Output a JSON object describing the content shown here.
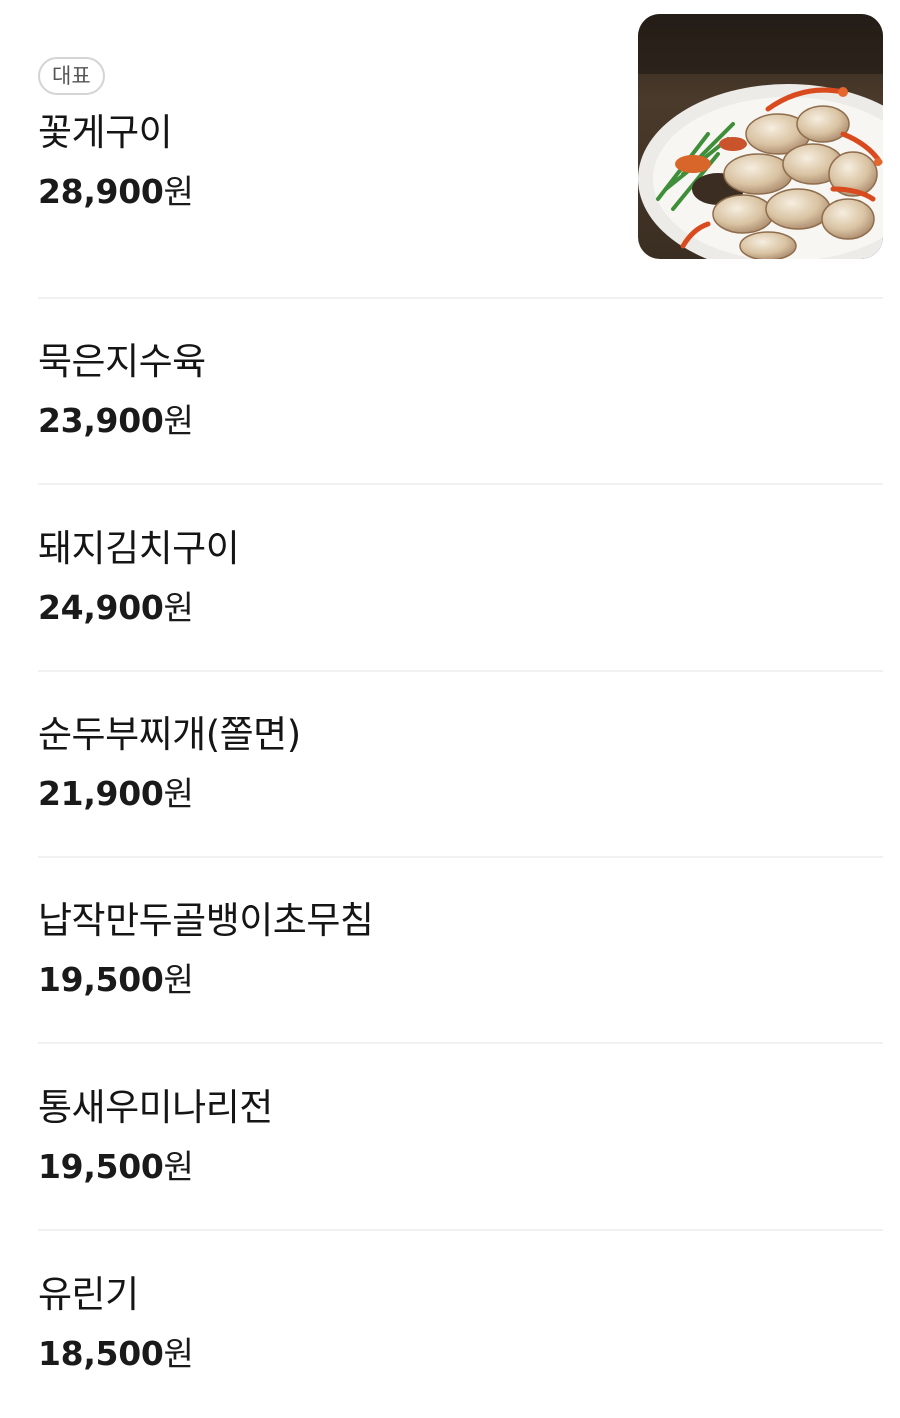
{
  "menu": {
    "featured_badge": "대표",
    "items": [
      {
        "name": "꽃게구이",
        "price": "28,900",
        "currency": "원",
        "featured": true,
        "image": "grilled-crab-photo"
      },
      {
        "name": "묵은지수육",
        "price": "23,900",
        "currency": "원"
      },
      {
        "name": "돼지김치구이",
        "price": "24,900",
        "currency": "원"
      },
      {
        "name": "순두부찌개(쫄면)",
        "price": "21,900",
        "currency": "원"
      },
      {
        "name": "납작만두골뱅이초무침",
        "price": "19,500",
        "currency": "원"
      },
      {
        "name": "통새우미나리전",
        "price": "19,500",
        "currency": "원"
      },
      {
        "name": "유린기",
        "price": "18,500",
        "currency": "원"
      }
    ]
  }
}
